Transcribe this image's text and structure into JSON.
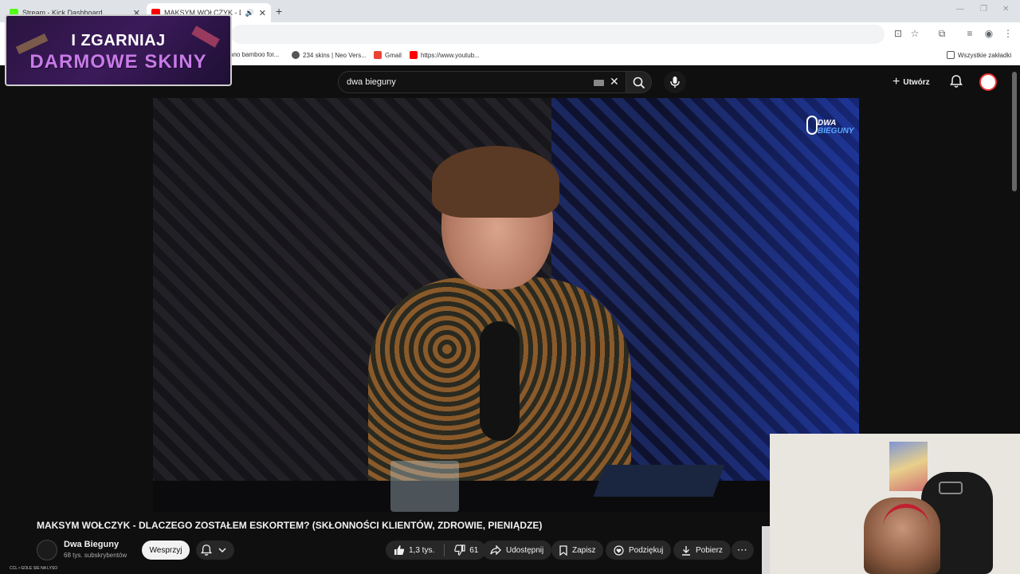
{
  "browser": {
    "tabs": [
      {
        "title": "Stream - Kick Dashboard",
        "favicon_color": "#53fc18",
        "active": false
      },
      {
        "title": "MAKSYM WOŁCZYK - DLAC",
        "favicon_color": "#ff0000",
        "active": true
      }
    ],
    "new_tab_label": "+",
    "bookmarks": [
      {
        "label": "ano bamboo for...",
        "color": "#4a8a4a"
      },
      {
        "label": "234 skins | Neo Vers...",
        "color": "#555555"
      },
      {
        "label": "Gmail",
        "color": "#ea4335"
      },
      {
        "label": "https://www.youtub...",
        "color": "#ff0000"
      }
    ],
    "all_bookmarks_label": "Wszystkie zakładki"
  },
  "promo": {
    "line1": "I ZGARNIAJ",
    "line2": "DARMOWE SKINY"
  },
  "youtube": {
    "search": {
      "query": "dwa bieguny"
    },
    "create_label": "Utwórz",
    "video": {
      "watermark_line1": "DWA",
      "watermark_line2": "BIEGUNY"
    },
    "title": "MAKSYM WOŁCZYK - DLACZEGO ZOSTAŁEM ESKORTEM? (SKŁONNOŚCI KLIENTÓW, ZDROWIE, PIENIĄDZE)",
    "channel": {
      "name": "Dwa Bieguny",
      "subscribers": "68 tys. subskrybentów"
    },
    "support_label": "Wesprzyj",
    "actions": {
      "likes": "1,3 tys.",
      "dislikes": "61",
      "share": "Udostępnij",
      "save": "Zapisz",
      "thanks": "Podziękuj",
      "download": "Pobierz"
    }
  },
  "overlay_note": "CCL • GOLE SIE NA LYSO",
  "colors": {
    "yt_bg": "#0f0f0f",
    "kick": "#53fc18",
    "yt_red": "#ff0000",
    "promo_purple": "#c87ae8"
  }
}
